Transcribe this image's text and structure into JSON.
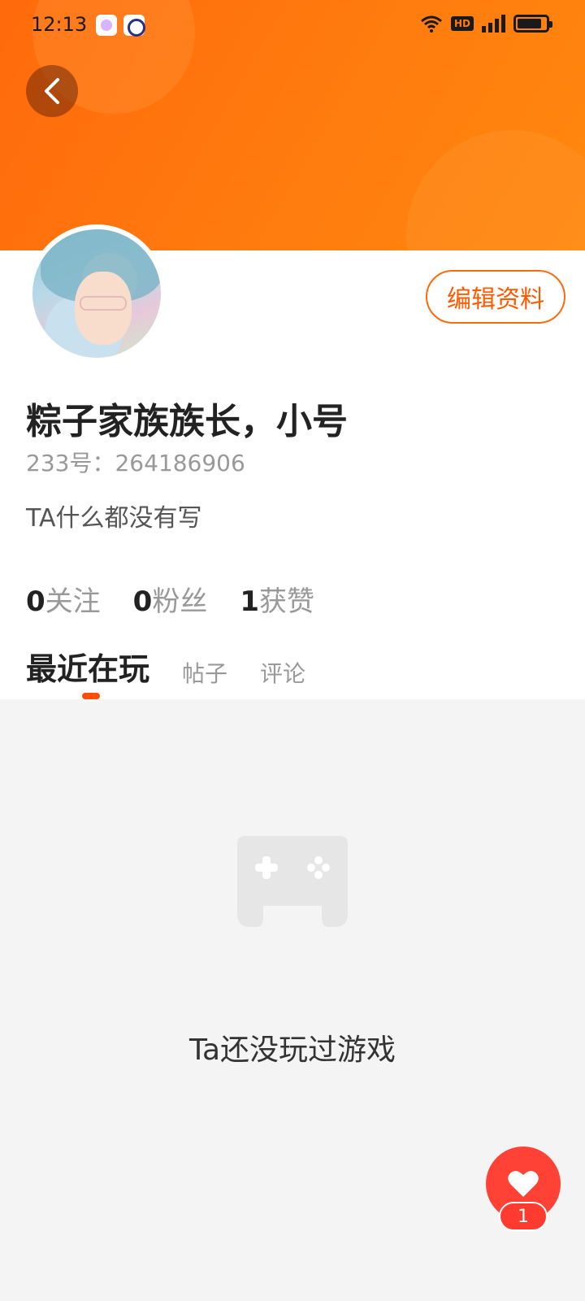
{
  "status_bar": {
    "time": "12:13",
    "network": "4G",
    "hd_badge": "HD",
    "battery_level": 0.8
  },
  "header": {
    "back_icon": "chevron-left-icon",
    "gradient_colors": [
      "#ff6a0c",
      "#ff880f"
    ]
  },
  "profile": {
    "edit_button_label": "编辑资料",
    "nickname": "粽子家族族长，小号",
    "user_id": "233号：264186906",
    "bio": "TA什么都没有写",
    "stats": [
      {
        "num": "0",
        "label": "关注"
      },
      {
        "num": "0",
        "label": "粉丝"
      },
      {
        "num": "1",
        "label": "获赞"
      }
    ]
  },
  "tabs": [
    {
      "label": "最近在玩",
      "active": true
    },
    {
      "label": "帖子",
      "active": false
    },
    {
      "label": "评论",
      "active": false
    }
  ],
  "empty_state": {
    "icon": "gamepad-icon",
    "text": "Ta还没玩过游戏"
  },
  "like_fab": {
    "icon": "heart-icon",
    "count": "1"
  },
  "colors": {
    "accent": "#ff5a00",
    "fab": "#ff4136"
  }
}
